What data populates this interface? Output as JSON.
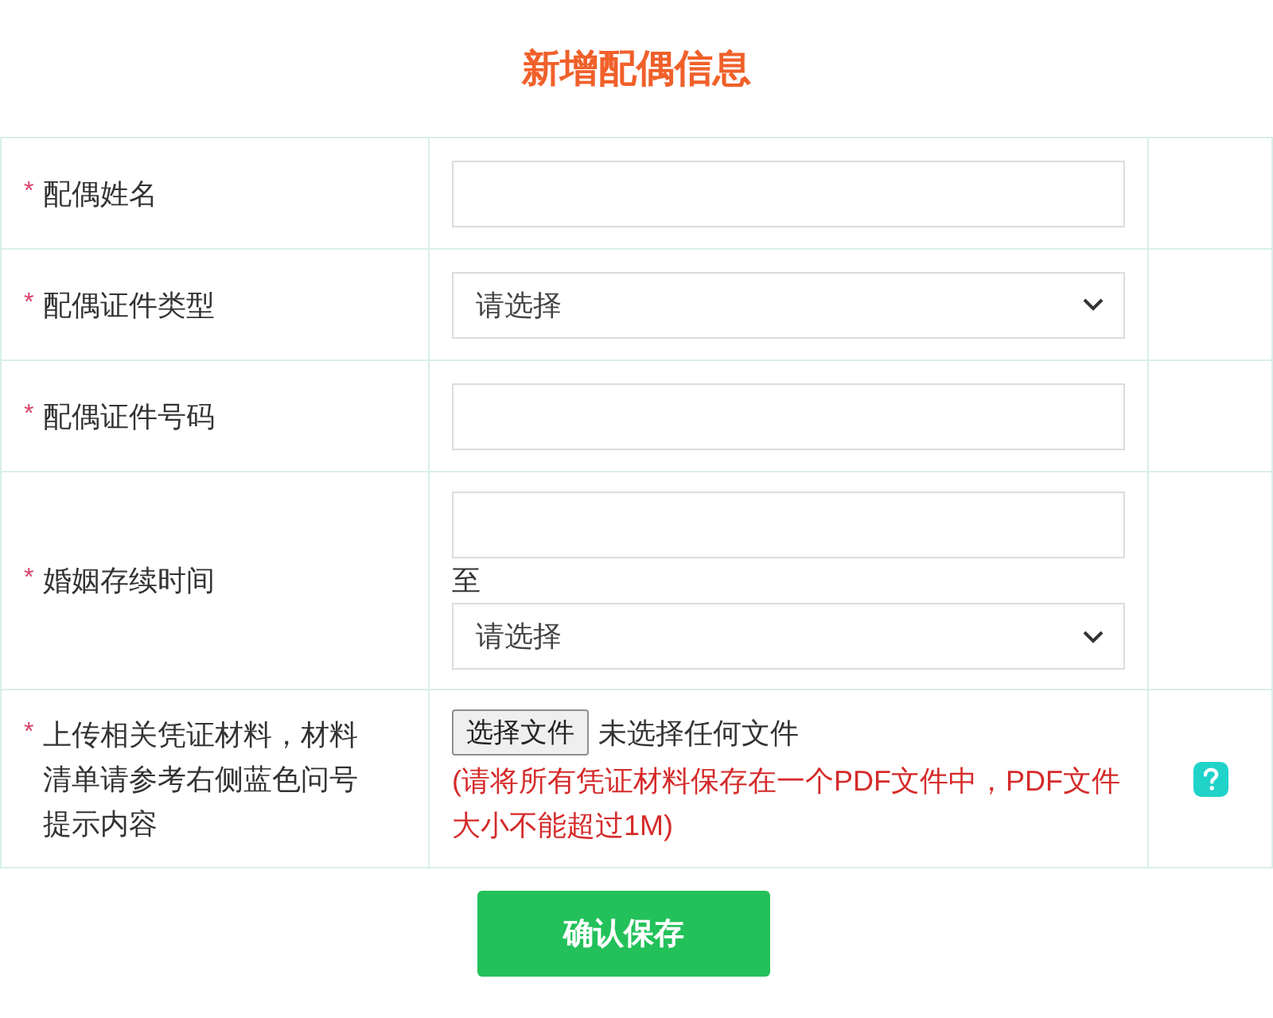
{
  "title": "新增配偶信息",
  "fields": [
    {
      "kind": "text",
      "required_mark": "*",
      "label": "配偶姓名",
      "help": false
    },
    {
      "kind": "select",
      "required_mark": "*",
      "label": "配偶证件类型",
      "placeholder": "请选择",
      "help": false
    },
    {
      "kind": "text",
      "required_mark": "*",
      "label": "配偶证件号码",
      "help": false
    },
    {
      "kind": "range",
      "required_mark": "*",
      "label": "婚姻存续时间",
      "separator": "至",
      "end_placeholder": "请选择",
      "help": false
    },
    {
      "kind": "file",
      "required_mark": "*",
      "label": "上传相关凭证材料，材料清单请参考右侧蓝色问号提示内容",
      "button": "选择文件",
      "status": "未选择任何文件",
      "note": "(请将所有凭证材料保存在一个PDF文件中，PDF文件大小不能超过1M)",
      "help": true
    }
  ],
  "submit": "确认保存"
}
